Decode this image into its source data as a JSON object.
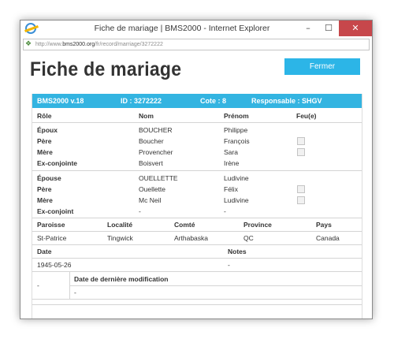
{
  "window": {
    "title": "Fiche de mariage | BMS2000 - Internet Explorer",
    "min": "–",
    "max": "☐",
    "close": "✕"
  },
  "address": {
    "prefix": "http://www.",
    "domain": "bms2000.org",
    "path": "/fr/record/marriage/3272222"
  },
  "page": {
    "title": "Fiche de mariage",
    "close_button": "Fermer"
  },
  "header_bar": {
    "version": "BMS2000 v.18",
    "id": "ID : 3272222",
    "cote": "Cote : 8",
    "responsable": "Responsable : SHGV"
  },
  "columns": {
    "role": "Rôle",
    "nom": "Nom",
    "prenom": "Prénom",
    "feu": "Feu(e)"
  },
  "groom_group": [
    {
      "role": "Époux",
      "nom": "BOUCHER",
      "prenom": "Philippe",
      "feu": false
    },
    {
      "role": "Père",
      "nom": "Boucher",
      "prenom": "François",
      "feu": true
    },
    {
      "role": "Mère",
      "nom": "Provencher",
      "prenom": "Sara",
      "feu": true
    },
    {
      "role": "Ex-conjointe",
      "nom": "Boisvert",
      "prenom": "Irène",
      "feu": false
    }
  ],
  "bride_group": [
    {
      "role": "Épouse",
      "nom": "OUELLETTE",
      "prenom": "Ludivine",
      "feu": false
    },
    {
      "role": "Père",
      "nom": "Ouellette",
      "prenom": "Félix",
      "feu": true
    },
    {
      "role": "Mère",
      "nom": "Mc Neil",
      "prenom": "Ludivine",
      "feu": true
    },
    {
      "role": "Ex-conjoint",
      "nom": "-",
      "prenom": "-",
      "feu": false
    }
  ],
  "location": {
    "headers": {
      "paroisse": "Paroisse",
      "localite": "Localité",
      "comte": "Comté",
      "province": "Province",
      "pays": "Pays"
    },
    "values": {
      "paroisse": "St-Patrice",
      "localite": "Tingwick",
      "comte": "Arthabaska",
      "province": "QC",
      "pays": "Canada"
    }
  },
  "dates": {
    "date_label": "Date",
    "notes_label": "Notes",
    "date_value": "1945-05-26",
    "notes_value": "-"
  },
  "modification": {
    "left_value": "-",
    "label": "Date de dernière modification",
    "value": "-"
  }
}
